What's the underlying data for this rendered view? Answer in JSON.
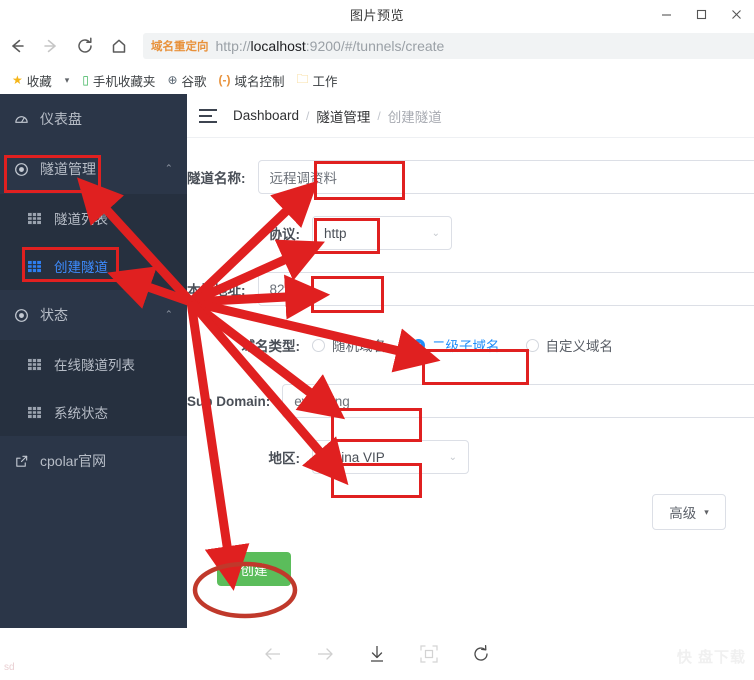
{
  "window": {
    "title": "图片预览",
    "controls": [
      {
        "name": "minimize",
        "glyph": "minimize-icon"
      },
      {
        "name": "maximize",
        "glyph": "maximize-icon"
      },
      {
        "name": "close",
        "glyph": "close-icon"
      }
    ]
  },
  "browser": {
    "nav": [
      {
        "name": "back-icon",
        "enabled": true
      },
      {
        "name": "forward-icon",
        "enabled": false
      },
      {
        "name": "reload-icon",
        "enabled": true
      },
      {
        "name": "home-icon",
        "enabled": true
      }
    ],
    "address": {
      "badge": "域名重定向",
      "url_prefix": "http://",
      "url_host": "localhost",
      "url_rest": ":9200/#/tunnels/create",
      "full_url": "http://localhost:9200/#/tunnels/create"
    },
    "bookmarks": [
      {
        "label": "收藏",
        "icon": "star-icon"
      },
      {
        "label": "手机收藏夹",
        "icon": "phone-icon"
      },
      {
        "label": "谷歌",
        "icon": "globe-icon"
      },
      {
        "label": "域名控制",
        "icon": "dns-icon"
      },
      {
        "label": "工作",
        "icon": "folder-icon"
      }
    ]
  },
  "sidebar": {
    "items": [
      {
        "label": "仪表盘",
        "icon": "dashboard-icon",
        "level": "top",
        "active": false,
        "collapsible": false
      },
      {
        "label": "隧道管理",
        "icon": "tunnel-icon",
        "level": "top",
        "active": false,
        "collapsible": true,
        "caret": "chevron-up-icon"
      },
      {
        "label": "隧道列表",
        "icon": "grid-icon",
        "level": "sub",
        "active": false
      },
      {
        "label": "创建隧道",
        "icon": "grid-icon",
        "level": "sub",
        "active": true
      },
      {
        "label": "状态",
        "icon": "status-icon",
        "level": "top",
        "active": false,
        "collapsible": true,
        "caret": "chevron-up-icon"
      },
      {
        "label": "在线隧道列表",
        "icon": "grid-icon",
        "level": "sub",
        "active": false
      },
      {
        "label": "系统状态",
        "icon": "grid-icon",
        "level": "sub",
        "active": false
      },
      {
        "label": "cpolar官网",
        "icon": "external-link-icon",
        "level": "top",
        "active": false
      }
    ]
  },
  "main": {
    "hamburger": "collapse-menu-icon",
    "breadcrumb": [
      {
        "label": "Dashboard",
        "muted": false
      },
      {
        "label": "隧道管理",
        "muted": false
      },
      {
        "label": "创建隧道",
        "muted": true
      }
    ],
    "breadcrumb_separator": "/",
    "form": {
      "tunnel_name": {
        "label": "隧道名称:",
        "value": "远程调资料"
      },
      "protocol": {
        "label": "协议:",
        "value": "http",
        "caret": "chevron-down-icon"
      },
      "local_addr": {
        "label": "本地地址:",
        "value": "82"
      },
      "domain_type": {
        "label": "域名类型:",
        "options": [
          {
            "label": "随机域名",
            "selected": false
          },
          {
            "label": "二级子域名",
            "selected": true
          },
          {
            "label": "自定义域名",
            "selected": false
          }
        ]
      },
      "sub_domain": {
        "label": "Sub Domain:",
        "value": "everthing"
      },
      "region": {
        "label": "地区:",
        "value": "China VIP",
        "caret": "chevron-down-icon"
      },
      "advanced_button": {
        "label": "高级",
        "caret": "caret-down-icon"
      },
      "create_button": {
        "label": "创建"
      }
    }
  },
  "bottom_toolbar": {
    "buttons": [
      {
        "name": "prev-image-icon",
        "dim": true
      },
      {
        "name": "next-image-icon",
        "dim": true
      },
      {
        "name": "download-icon",
        "dim": false
      },
      {
        "name": "fit-screen-icon",
        "dim": true
      },
      {
        "name": "rotate-icon",
        "dim": false
      }
    ],
    "watermark": "快 盘下载",
    "corner_text": "sd"
  },
  "colors": {
    "sidebar_bg": "#2b3648",
    "sidebar_sub_bg": "#26303f",
    "accent_blue": "#3d8bfd",
    "annotation_red": "#e02020",
    "create_green": "#5bbd5b",
    "badge_orange": "#e8913a"
  }
}
